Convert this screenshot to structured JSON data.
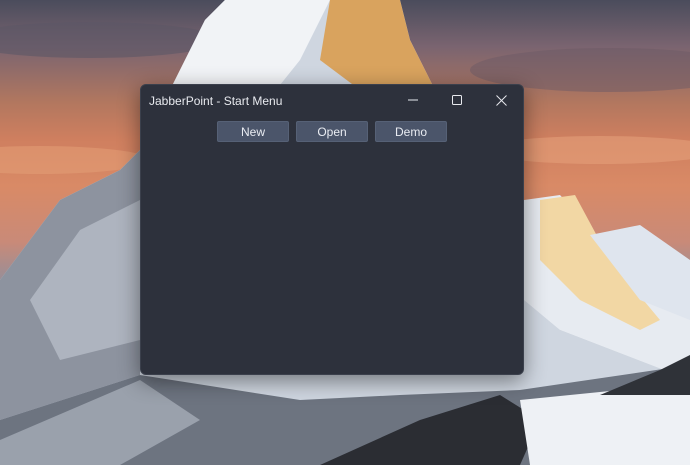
{
  "window": {
    "title": "JabberPoint - Start Menu",
    "controls": {
      "minimize": "minimize-icon",
      "maximize": "maximize-icon",
      "close": "close-icon"
    }
  },
  "menu": {
    "new_label": "New",
    "open_label": "Open",
    "demo_label": "Demo"
  },
  "colors": {
    "window_bg": "#2d313c",
    "button_bg": "#4b556a",
    "text": "#e8eaef"
  }
}
